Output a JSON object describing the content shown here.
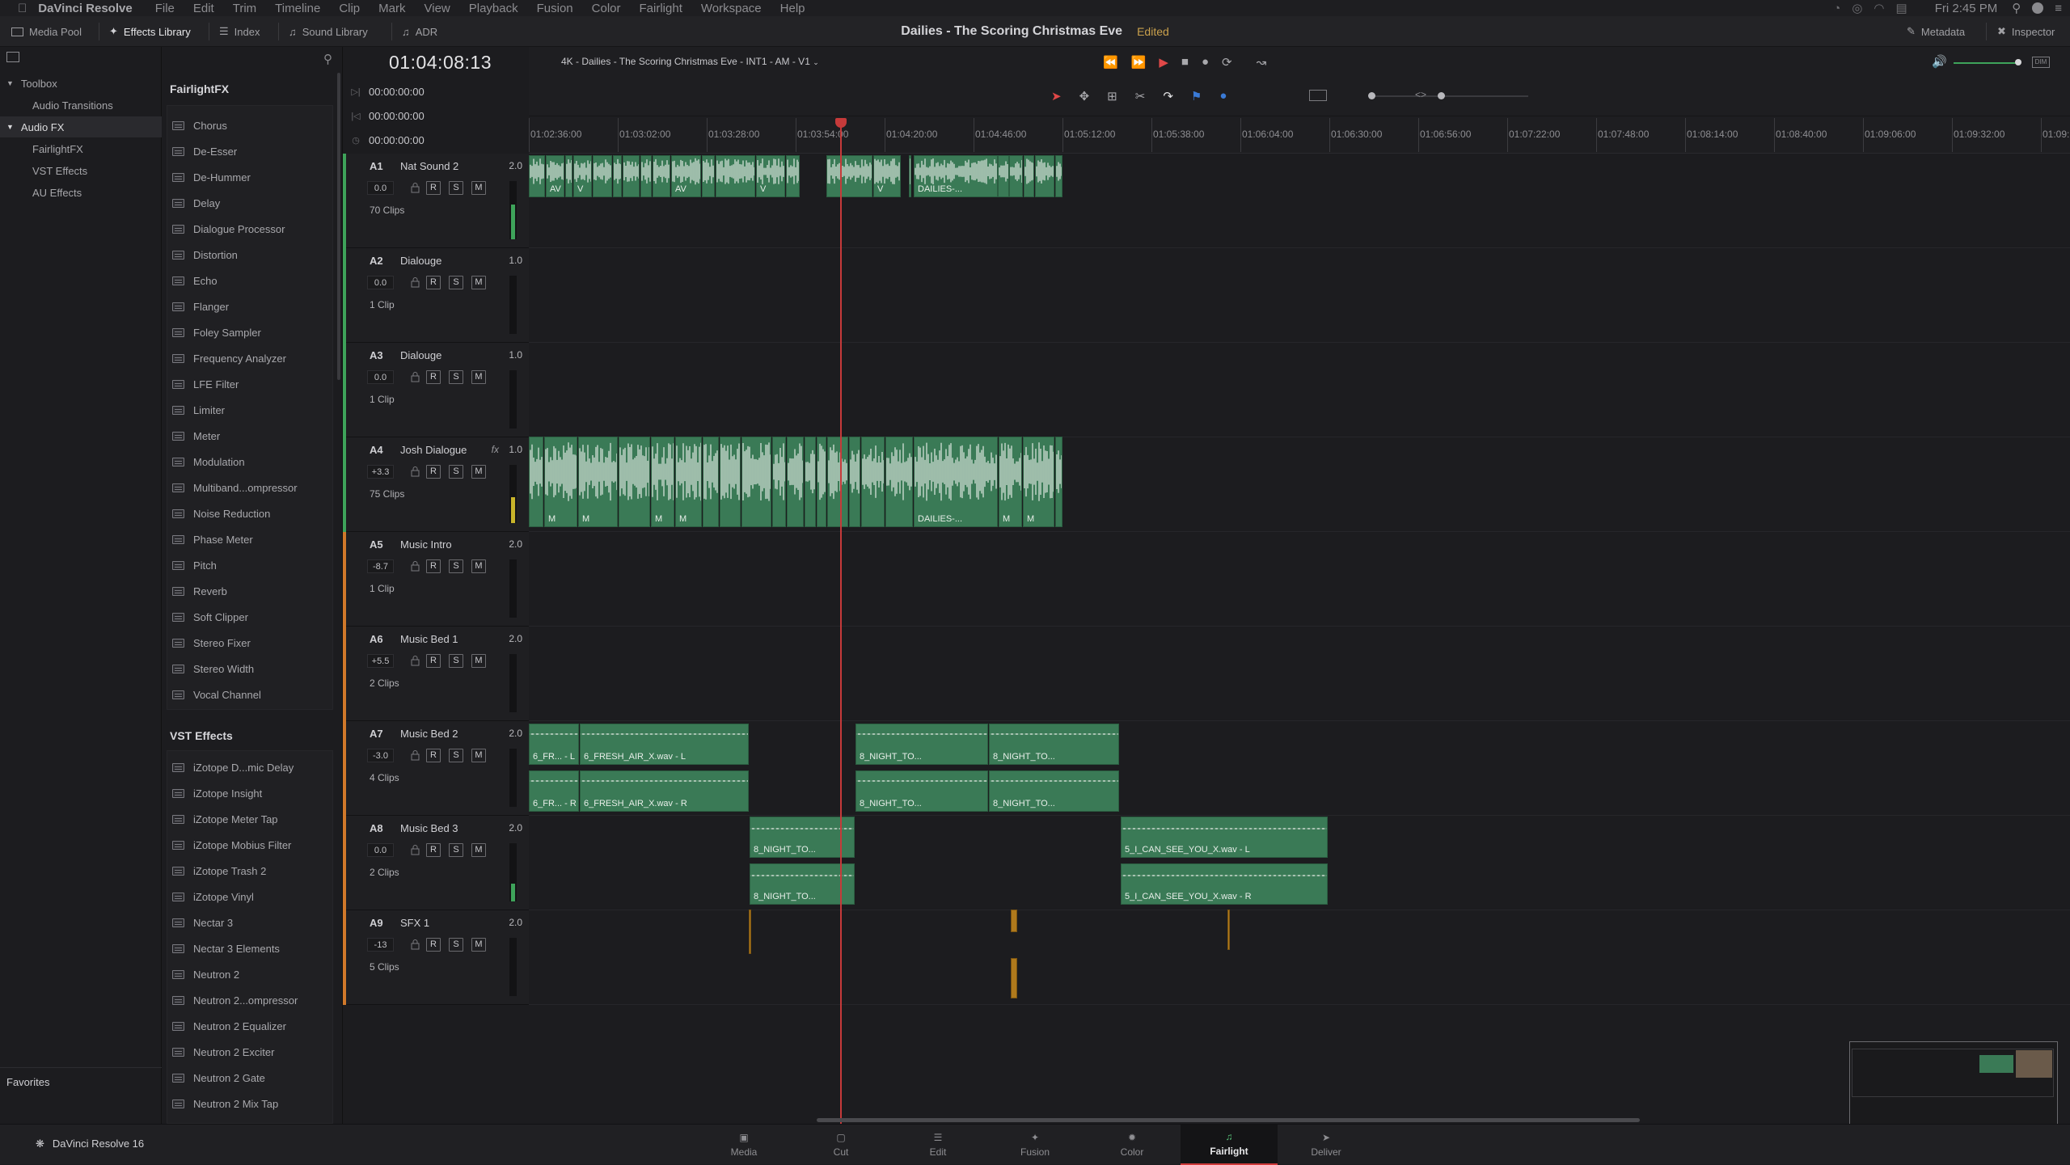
{
  "menubar": {
    "app": "DaVinci Resolve",
    "items": [
      "File",
      "Edit",
      "Trim",
      "Timeline",
      "Clip",
      "Mark",
      "View",
      "Playback",
      "Fusion",
      "Color",
      "Fairlight",
      "Workspace",
      "Help"
    ],
    "clock": "Fri 2:45 PM"
  },
  "toolbar": {
    "media_pool": "Media Pool",
    "effects_library": "Effects Library",
    "index": "Index",
    "sound_library": "Sound Library",
    "adr": "ADR",
    "metadata": "Metadata",
    "inspector": "Inspector"
  },
  "project": {
    "title": "Dailies - The Scoring Christmas Eve",
    "status": "Edited"
  },
  "leftpane": {
    "toolbox": "Toolbox",
    "audio_transitions": "Audio Transitions",
    "audio_fx": "Audio FX",
    "fairlightfx": "FairlightFX",
    "vst": "VST Effects",
    "au": "AU Effects",
    "favorites": "Favorites"
  },
  "fx": {
    "fairlight_header": "FairlightFX",
    "fairlight_items": [
      "Chorus",
      "De-Esser",
      "De-Hummer",
      "Delay",
      "Dialogue Processor",
      "Distortion",
      "Echo",
      "Flanger",
      "Foley Sampler",
      "Frequency Analyzer",
      "LFE Filter",
      "Limiter",
      "Meter",
      "Modulation",
      "Multiband...ompressor",
      "Noise Reduction",
      "Phase Meter",
      "Pitch",
      "Reverb",
      "Soft Clipper",
      "Stereo Fixer",
      "Stereo Width",
      "Vocal Channel"
    ],
    "vst_header": "VST Effects",
    "vst_items": [
      "iZotope D...mic Delay",
      "iZotope Insight",
      "iZotope Meter Tap",
      "iZotope Mobius Filter",
      "iZotope Trash 2",
      "iZotope Vinyl",
      "Nectar 3",
      "Nectar 3 Elements",
      "Neutron 2",
      "Neutron 2...ompressor",
      "Neutron 2 Equalizer",
      "Neutron 2 Exciter",
      "Neutron 2 Gate",
      "Neutron 2 Mix Tap"
    ]
  },
  "timeline": {
    "timecode": "01:04:08:13",
    "name": "4K - Dailies - The Scoring Christmas Eve - INT1 - AM - V1",
    "tc_rows": [
      "00:00:00:00",
      "00:00:00:00",
      "00:00:00:00"
    ],
    "ruler": [
      "01:02:36:00",
      "01:03:02:00",
      "01:03:28:00",
      "01:03:54:00",
      "01:04:20:00",
      "01:04:46:00",
      "01:05:12:00",
      "01:05:38:00",
      "01:06:04:00",
      "01:06:30:00",
      "01:06:56:00",
      "01:07:22:00",
      "01:07:48:00",
      "01:08:14:00",
      "01:08:40:00",
      "01:09:06:00",
      "01:09:32:00",
      "01:09:"
    ]
  },
  "tracks": [
    {
      "id": "A1",
      "name": "Nat Sound 2",
      "num": "2.0",
      "vol": "0.0",
      "clips": "70 Clips",
      "fx": ""
    },
    {
      "id": "A2",
      "name": "Dialouge",
      "num": "1.0",
      "vol": "0.0",
      "clips": "1 Clip",
      "fx": ""
    },
    {
      "id": "A3",
      "name": "Dialouge",
      "num": "1.0",
      "vol": "0.0",
      "clips": "1 Clip",
      "fx": ""
    },
    {
      "id": "A4",
      "name": "Josh Dialogue",
      "num": "1.0",
      "vol": "+3.3",
      "clips": "75 Clips",
      "fx": "fx"
    },
    {
      "id": "A5",
      "name": "Music Intro",
      "num": "2.0",
      "vol": "-8.7",
      "clips": "1 Clip",
      "fx": ""
    },
    {
      "id": "A6",
      "name": "Music Bed 1",
      "num": "2.0",
      "vol": "+5.5",
      "clips": "2 Clips",
      "fx": ""
    },
    {
      "id": "A7",
      "name": "Music Bed 2",
      "num": "2.0",
      "vol": "-3.0",
      "clips": "4 Clips",
      "fx": ""
    },
    {
      "id": "A8",
      "name": "Music Bed 3",
      "num": "2.0",
      "vol": "0.0",
      "clips": "2 Clips",
      "fx": ""
    },
    {
      "id": "A9",
      "name": "SFX 1",
      "num": "2.0",
      "vol": "-13",
      "clips": "5 Clips",
      "fx": ""
    }
  ],
  "track_buttons": {
    "r": "R",
    "s": "S",
    "m": "M"
  },
  "clip_labels": {
    "a1": [
      "AV",
      "V",
      "",
      "AV",
      "V",
      "V",
      "V",
      "",
      "",
      "DAILIES-..."
    ],
    "a4": [
      "M",
      "M",
      "",
      "M",
      "M",
      "",
      "",
      "",
      "DAILIES-...",
      "M",
      "M",
      "",
      "M",
      "M"
    ],
    "a7": [
      "6_FR... - L",
      "6_FRESH_AIR_X.wav - L",
      "8_NIGHT_TO...",
      "8_NIGHT_TO...",
      "6_FR... - R",
      "6_FRESH_AIR_X.wav - R",
      "8_NIGHT_TO...",
      "8_NIGHT_TO..."
    ],
    "a8": [
      "8_NIGHT_TO...",
      "5_I_CAN_SEE_YOU_X.wav - L",
      "8_NIGHT_TO...",
      "5_I_CAN_SEE_YOU_X.wav - R"
    ]
  },
  "pages": [
    "Media",
    "Cut",
    "Edit",
    "Fusion",
    "Color",
    "Fairlight",
    "Deliver"
  ],
  "bottom_app": "DaVinci Resolve 16",
  "colors": {
    "clip_green": "#3a7a56",
    "playhead": "#c63a3a",
    "accent_orange": "#c9a04c"
  }
}
